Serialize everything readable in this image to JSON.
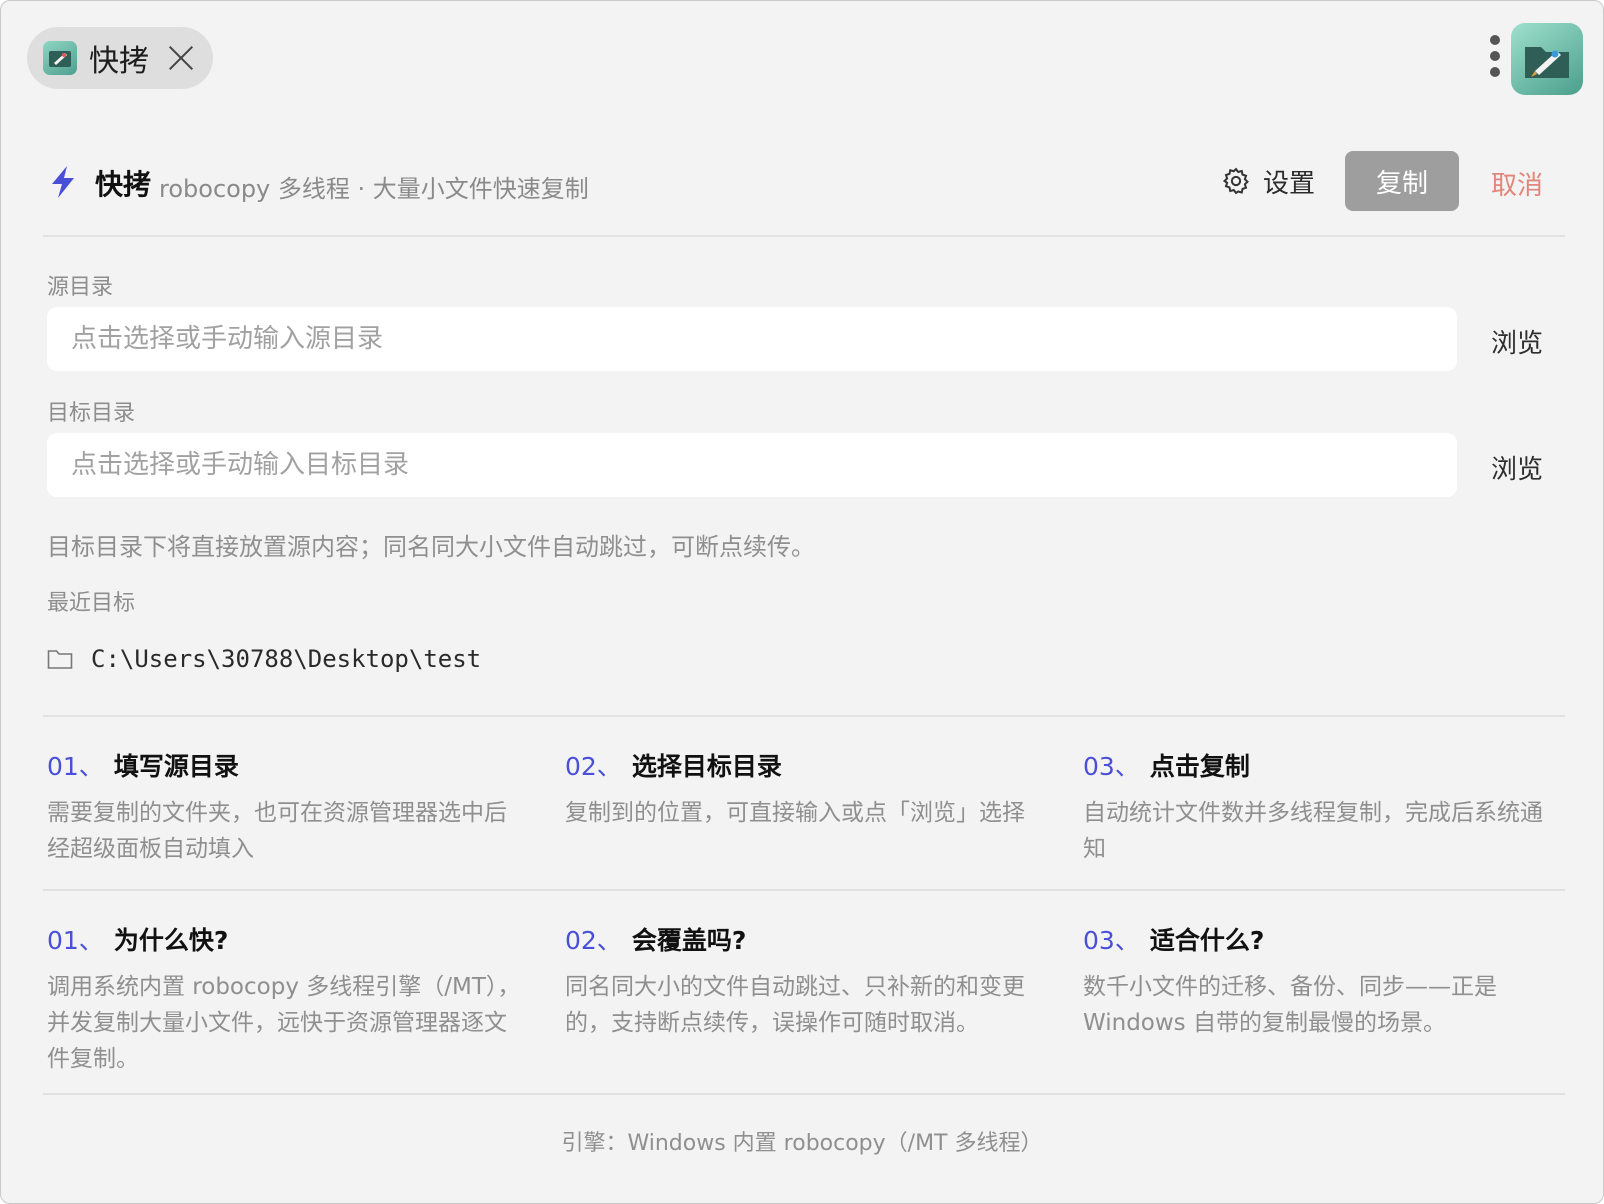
{
  "tab": {
    "title": "快拷"
  },
  "header": {
    "app_name": "快拷",
    "subtitle": "robocopy 多线程 · 大量小文件快速复制",
    "settings_label": "设置",
    "copy_label": "复制",
    "cancel_label": "取消"
  },
  "source": {
    "label": "源目录",
    "value": "",
    "placeholder": "点击选择或手动输入源目录",
    "browse_label": "浏览"
  },
  "target": {
    "label": "目标目录",
    "value": "",
    "placeholder": "点击选择或手动输入目标目录",
    "browse_label": "浏览"
  },
  "hint": "目标目录下将直接放置源内容；同名同大小文件自动跳过，可断点续传。",
  "recent": {
    "label": "最近目标",
    "items": [
      "C:\\Users\\30788\\Desktop\\test"
    ]
  },
  "steps": [
    {
      "num": "01、",
      "title": "填写源目录",
      "body": "需要复制的文件夹，也可在资源管理器选中后经超级面板自动填入"
    },
    {
      "num": "02、",
      "title": "选择目标目录",
      "body": "复制到的位置，可直接输入或点「浏览」选择"
    },
    {
      "num": "03、",
      "title": "点击复制",
      "body": "自动统计文件数并多线程复制，完成后系统通知"
    }
  ],
  "faq": [
    {
      "num": "01、",
      "title": "为什么快?",
      "body": "调用系统内置 robocopy 多线程引擎（/MT），并发复制大量小文件，远快于资源管理器逐文件复制。"
    },
    {
      "num": "02、",
      "title": "会覆盖吗?",
      "body": "同名同大小的文件自动跳过、只补新的和变更的，支持断点续传，误操作可随时取消。"
    },
    {
      "num": "03、",
      "title": "适合什么?",
      "body": "数千小文件的迁移、备份、同步——正是 Windows 自带的复制最慢的场景。"
    }
  ],
  "footer": "引擎：Windows 内置 robocopy（/MT 多线程）",
  "colors": {
    "accent": "#4a4fd8",
    "cancel": "#e0867a",
    "copy_button": "#9e9e9e",
    "background": "#f3f3f3"
  },
  "icons": {
    "tab_app": "rocket-folder-icon",
    "close": "close-icon",
    "menu": "kebab-menu-icon",
    "header": "lightning-icon",
    "settings": "gear-icon",
    "recent": "folder-icon"
  }
}
